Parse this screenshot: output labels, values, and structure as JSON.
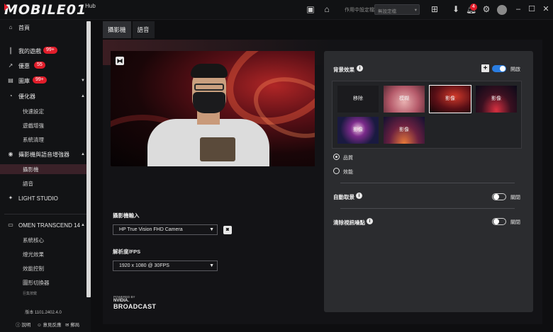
{
  "app": {
    "logo_text": "MOBILE01",
    "logo_sub": "Hub"
  },
  "titlebar": {
    "mode_label": "作用中設定檔",
    "mode_select": "無設定檔",
    "notif_count": "4"
  },
  "sidebar": {
    "items": [
      {
        "label": "首頁"
      },
      {
        "label": "我的遊戲",
        "badge": "99+"
      },
      {
        "label": "優惠",
        "badge": "55"
      },
      {
        "label": "圖庫",
        "badge": "99+"
      },
      {
        "label": "優化器"
      },
      {
        "label": "快速設定"
      },
      {
        "label": "遊戲增強"
      },
      {
        "label": "系統清理"
      },
      {
        "label": "攝影機與語音增強器"
      },
      {
        "label": "攝影機"
      },
      {
        "label": "語音"
      },
      {
        "label": "LIGHT STUDIO"
      },
      {
        "label": "OMEN TRANSCEND 14"
      },
      {
        "label": "系統核心"
      },
      {
        "label": "燈光效果"
      },
      {
        "label": "效能控制"
      },
      {
        "label": "圖形切換器"
      },
      {
        "label": "巨集按鍵"
      }
    ],
    "version": "版本 1101.2402.4.0",
    "footer": [
      "說明",
      "意見反應",
      "郵局"
    ]
  },
  "tabs": [
    {
      "label": "攝影機",
      "active": true
    },
    {
      "label": "語音",
      "active": false
    }
  ],
  "camera": {
    "input_label": "攝影機輸入",
    "input_value": "HP True Vision FHD Camera",
    "fps_label": "解析度/FPS",
    "fps_value": "1920 x 1080 @ 30FPS",
    "powered": "POWERED BY",
    "nvidia": "NVIDIA.",
    "broadcast": "BROADCAST"
  },
  "panel": {
    "bg_effect_title": "背景效果",
    "bg_toggle_label": "開啟",
    "bg_toggle_on": true,
    "effects": [
      {
        "label": "移除"
      },
      {
        "label": "模糊"
      },
      {
        "label": "影像",
        "selected": true
      },
      {
        "label": "影像"
      },
      {
        "label": "影像"
      },
      {
        "label": "影像"
      }
    ],
    "quality_options": [
      {
        "label": "品質",
        "checked": true
      },
      {
        "label": "效能",
        "checked": false
      }
    ],
    "auto_frame_title": "自動取景",
    "auto_frame_label": "關閉",
    "denoise_title": "清除視訊噪點",
    "denoise_label": "關閉"
  }
}
